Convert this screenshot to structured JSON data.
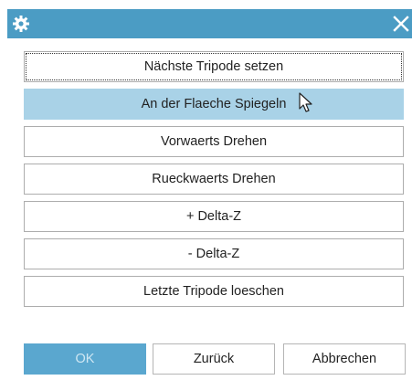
{
  "titlebar": {
    "icon": "gear-icon",
    "close_icon": "close-icon",
    "color": "#4b9cc4"
  },
  "commands": [
    {
      "label": "Nächste Tripode setzen",
      "state": "focused"
    },
    {
      "label": "An der Flaeche Spiegeln",
      "state": "hover"
    },
    {
      "label": "Vorwaerts Drehen",
      "state": "normal"
    },
    {
      "label": "Rueckwaerts Drehen",
      "state": "normal"
    },
    {
      "label": "+ Delta-Z",
      "state": "normal"
    },
    {
      "label": "- Delta-Z",
      "state": "normal"
    },
    {
      "label": "Letzte Tripode loeschen",
      "state": "normal"
    }
  ],
  "footer": {
    "ok_label": "OK",
    "back_label": "Zurück",
    "cancel_label": "Abbrechen"
  },
  "colors": {
    "accent": "#5aa7cf",
    "hover": "#a9d2e7"
  }
}
